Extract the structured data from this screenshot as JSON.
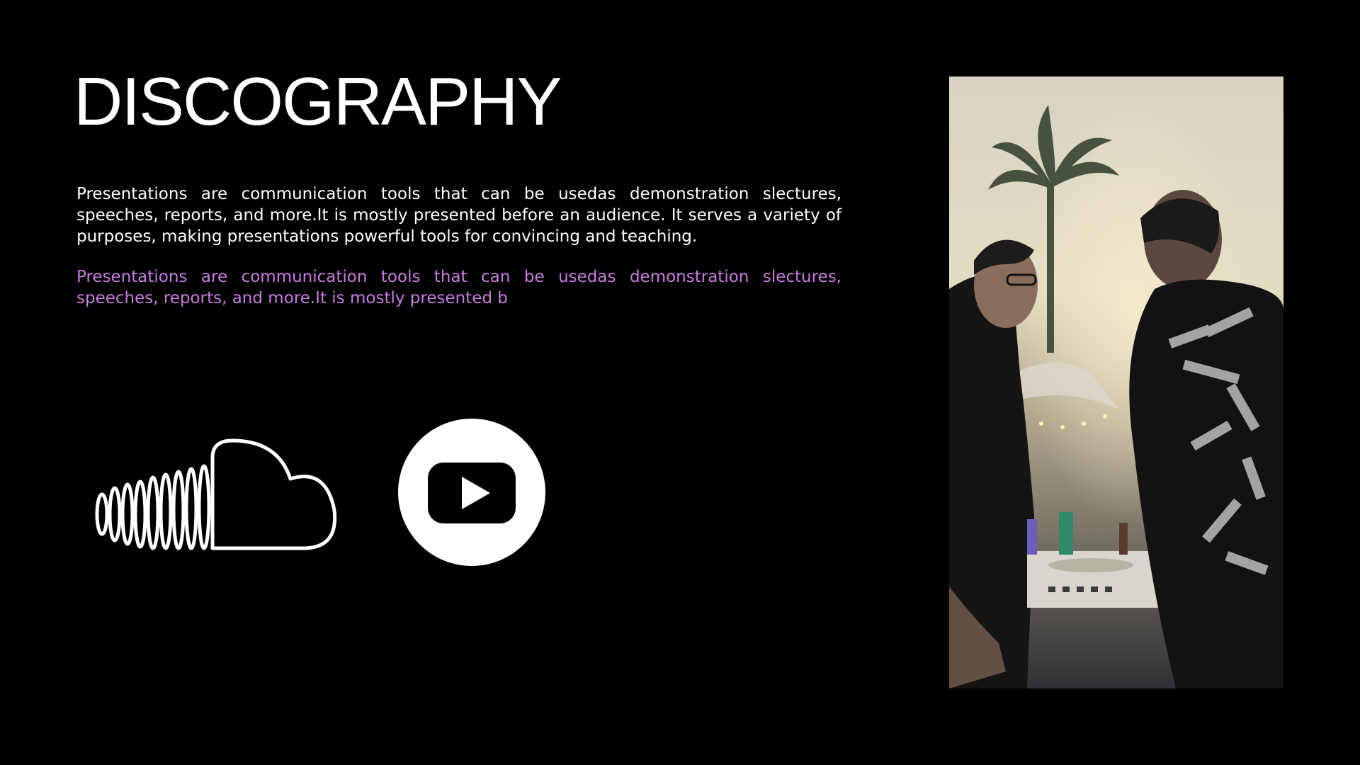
{
  "slide": {
    "title": "DISCOGRAPHY",
    "paragraph_primary": "Presentations are communication tools that can be usedas demonstration slectures, speeches, reports, and more.It is mostly presented before an audience. It serves a variety of purposes, making presentations powerful tools for convincing and teaching.",
    "paragraph_accent": "Presentations are communication tools that can be usedas demonstration slectures, speeches, reports, and more.It is mostly presented b",
    "icons": [
      "soundcloud-icon",
      "youtube-icon"
    ],
    "colors": {
      "background": "#000000",
      "text": "#ffffff",
      "accent": "#c77ddf"
    },
    "photo": {
      "description_icon": "dj-photo"
    }
  }
}
